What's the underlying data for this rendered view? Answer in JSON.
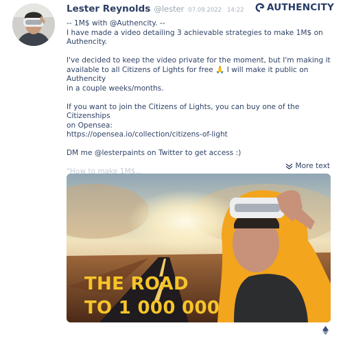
{
  "post": {
    "author": "Lester Reynolds",
    "handle": "@lester",
    "date": "07.09.2022",
    "time": "14:22",
    "brand": "AUTHENCITY",
    "lines": [
      "-- 1M$ with @Authencity. --",
      "I have made a video detailing 3 achievable strategies to make 1M$ on",
      "Authencity.",
      "",
      "I've decided to keep the video private for the moment, but I'm making it",
      "available to all Citizens of Lights for free 🙏 I will make it public on Authencity",
      "in a couple weeks/months.",
      "",
      "If you want to join the Citizens of Lights, you can buy one of the Citizenships",
      "on Opensea:",
      "https://opensea.io/collection/citizens-of-light",
      "",
      "DM me @lesterpaints on Twitter to get access :)",
      "",
      "\"How to make 1M$..."
    ],
    "more_label": "More text",
    "media_caption_line1": "THE ROAD",
    "media_caption_line2": "TO 1 000 000"
  },
  "colors": {
    "text": "#2f4266",
    "author": "#2b3e63",
    "muted": "#9aa4b4",
    "brand": "#253a66",
    "caption": "#f6c42a",
    "outline": "#f2a51d"
  },
  "icons": [
    "avatar",
    "authencity-logo-icon",
    "chevron-down-icon",
    "ethereum-icon"
  ]
}
